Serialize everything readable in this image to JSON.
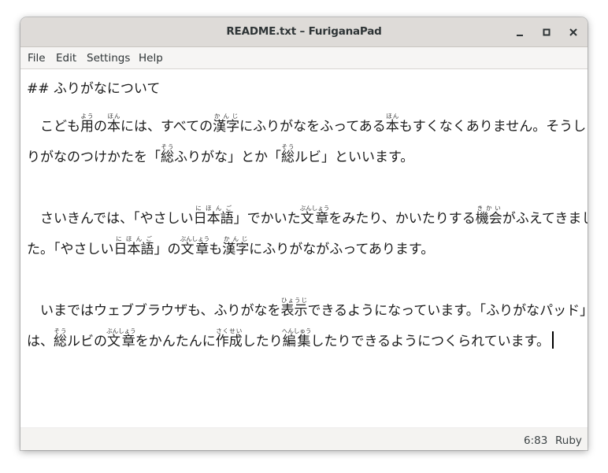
{
  "window": {
    "title": "README.txt – FuriganaPad",
    "controls": {
      "minimize": "minimize-icon",
      "maximize": "maximize-icon",
      "close": "close-icon"
    }
  },
  "menu": [
    "File",
    "Edit",
    "Settings",
    "Help"
  ],
  "document": {
    "lines": [
      [
        {
          "t": "## ふりがなについて"
        }
      ],
      [
        {
          "t": "　こども"
        },
        {
          "k": "用",
          "r": "よう"
        },
        {
          "t": "の"
        },
        {
          "k": "本",
          "r": "ほん"
        },
        {
          "t": "には、すべての"
        },
        {
          "k": "漢字",
          "r": "かんじ"
        },
        {
          "t": "にふりがなをふってある"
        },
        {
          "k": "本",
          "r": "ほん"
        },
        {
          "t": "もすくなくありません。そうしたふ"
        }
      ],
      [
        {
          "t": "りがなのつけかたを「"
        },
        {
          "k": "総",
          "r": "そう"
        },
        {
          "t": "ふりがな」とか「"
        },
        {
          "k": "総",
          "r": "そう"
        },
        {
          "t": "ルビ」といいます。"
        }
      ],
      [],
      [
        {
          "t": "　さいきんでは、「やさしい"
        },
        {
          "k": "日本語",
          "r": "にほんご"
        },
        {
          "t": "」でかいた"
        },
        {
          "k": "文章",
          "r": "ぶんしょう"
        },
        {
          "t": "をみたり、かいたりする"
        },
        {
          "k": "機会",
          "r": "きかい"
        },
        {
          "t": "がふえてきまし"
        }
      ],
      [
        {
          "t": "た。「やさしい"
        },
        {
          "k": "日本語",
          "r": "にほんご"
        },
        {
          "t": "」の"
        },
        {
          "k": "文章",
          "r": "ぶんしょう"
        },
        {
          "t": "も"
        },
        {
          "k": "漢字",
          "r": "かんじ"
        },
        {
          "t": "にふりがながふってあります。"
        }
      ],
      [],
      [
        {
          "t": "　いまではウェブブラウザも、ふりがなを"
        },
        {
          "k": "表示",
          "r": "ひょうじ"
        },
        {
          "t": "できるようになっています。「ふりがなパッド」"
        }
      ],
      [
        {
          "t": "は、"
        },
        {
          "k": "総",
          "r": "そう"
        },
        {
          "t": "ルビの"
        },
        {
          "k": "文章",
          "r": "ぶんしょう"
        },
        {
          "t": "をかんたんに"
        },
        {
          "k": "作成",
          "r": "さくせい"
        },
        {
          "t": "したり"
        },
        {
          "k": "編集",
          "r": "へんしゅう"
        },
        {
          "t": "したりできるようにつくられています。"
        }
      ]
    ]
  },
  "status": {
    "cursor_position": "6:83",
    "mode": "Ruby"
  }
}
